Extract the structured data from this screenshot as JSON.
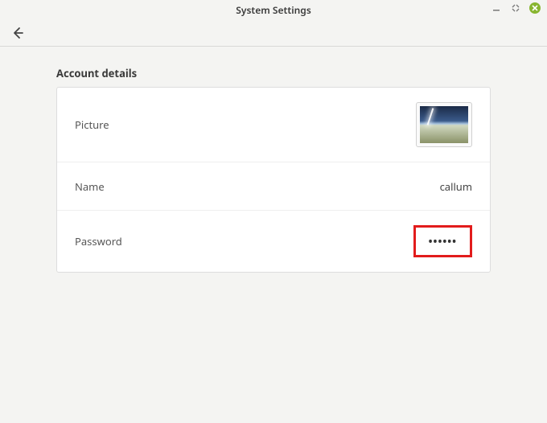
{
  "window": {
    "title": "System Settings"
  },
  "section": {
    "title": "Account details"
  },
  "rows": {
    "picture": {
      "label": "Picture"
    },
    "name": {
      "label": "Name",
      "value": "callum"
    },
    "password": {
      "label": "Password",
      "masked": "••••••"
    }
  },
  "icons": {
    "back": "back-arrow",
    "minimize": "minimize",
    "maximize": "maximize-toggle",
    "close": "close"
  }
}
